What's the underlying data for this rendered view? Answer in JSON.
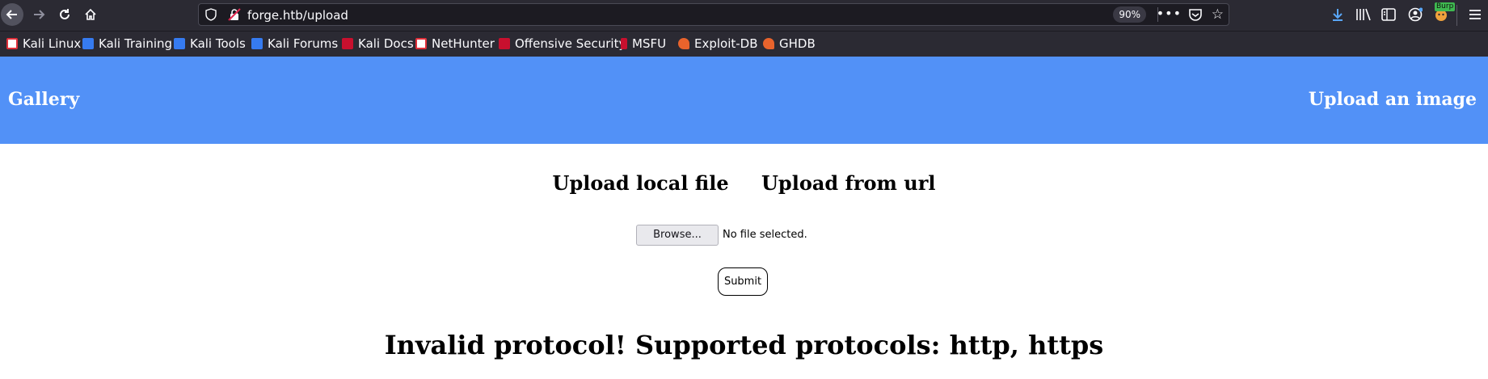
{
  "browser": {
    "url": "forge.htb/upload",
    "zoom": "90%",
    "burp_label": "Burp"
  },
  "bookmarks": [
    {
      "label": "Kali Linux",
      "icon": "kali-dragon-icon",
      "color": "#e0303a"
    },
    {
      "label": "Kali Training",
      "icon": "kali-training-icon",
      "color": "#367bf0"
    },
    {
      "label": "Kali Tools",
      "icon": "kali-tools-icon",
      "color": "#367bf0"
    },
    {
      "label": "Kali Forums",
      "icon": "kali-forums-icon",
      "color": "#367bf0"
    },
    {
      "label": "Kali Docs",
      "icon": "kali-docs-icon",
      "color": "#c8102e"
    },
    {
      "label": "NetHunter",
      "icon": "nethunter-icon",
      "color": "#e0303a"
    },
    {
      "label": "Offensive Security",
      "icon": "offsec-icon",
      "color": "#c8102e"
    },
    {
      "label": "MSFU",
      "icon": "msfu-icon",
      "color": "#c8102e"
    },
    {
      "label": "Exploit-DB",
      "icon": "exploit-db-icon",
      "color": "#e8632c"
    },
    {
      "label": "GHDB",
      "icon": "ghdb-icon",
      "color": "#e8632c"
    }
  ],
  "site": {
    "gallery_link": "Gallery",
    "upload_link": "Upload an image",
    "tab_local": "Upload local file",
    "tab_url": "Upload from url",
    "browse_label": "Browse...",
    "file_status": "No file selected.",
    "submit_label": "Submit",
    "message": "Invalid protocol! Supported protocols: http, https",
    "header_color": "#5291f7"
  }
}
